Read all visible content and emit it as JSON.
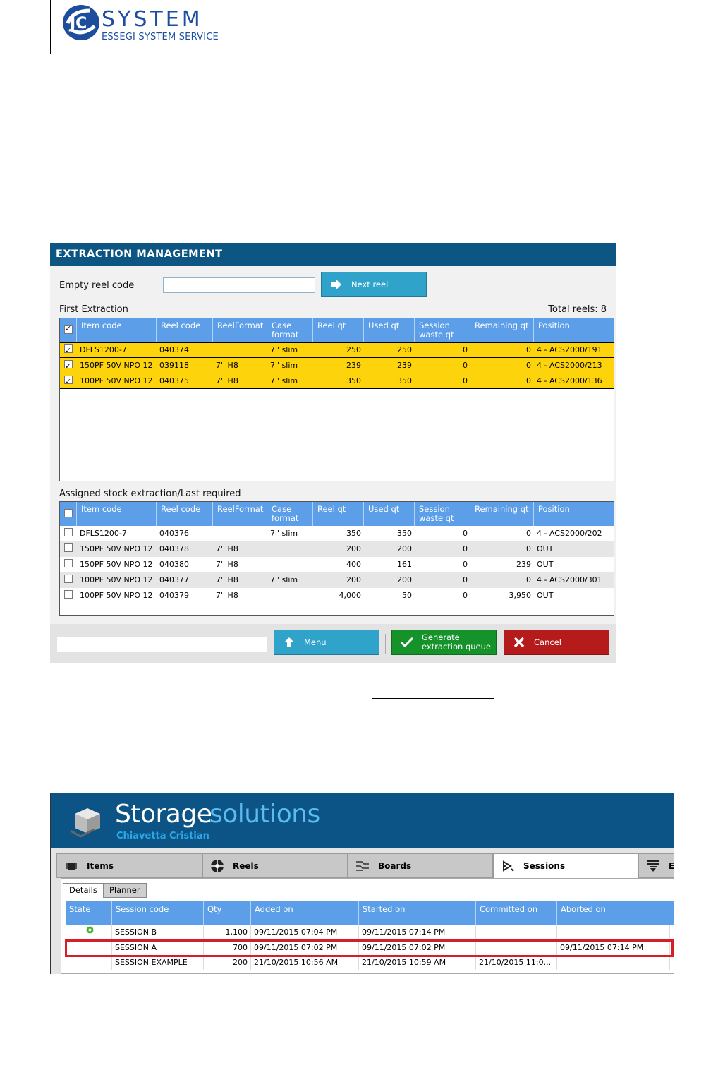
{
  "header": {
    "logo_text": "SYSTEM",
    "logo_subtitle": "ESSEGI SYSTEM SERVICE",
    "brand_color": "#1d4e9e"
  },
  "extraction": {
    "title": "EXTRACTION MANAGEMENT",
    "empty_reel_label": "Empty reel code",
    "empty_reel_value": "",
    "next_reel_label": "Next reel",
    "first_extraction_label": "First Extraction",
    "total_reels": "Total reels: 8",
    "columns": [
      "Item code",
      "Reel code",
      "ReelFormat",
      "Case format",
      "Reel qt",
      "Used qt",
      "Session waste qt",
      "Remaining qt",
      "Position"
    ],
    "first_rows": [
      {
        "checked": true,
        "item": "DFLS1200-7",
        "reel": "040374",
        "format": "",
        "case": "7'' slim",
        "reel_qt": "250",
        "used": "250",
        "waste": "0",
        "remaining": "0",
        "position": "4 - ACS2000/191"
      },
      {
        "checked": true,
        "item": "150PF 50V NPO 12",
        "reel": "039118",
        "format": "7'' H8",
        "case": "7'' slim",
        "reel_qt": "239",
        "used": "239",
        "waste": "0",
        "remaining": "0",
        "position": "4 - ACS2000/213"
      },
      {
        "checked": true,
        "item": "100PF 50V NPO 12",
        "reel": "040375",
        "format": "7'' H8",
        "case": "7'' slim",
        "reel_qt": "350",
        "used": "350",
        "waste": "0",
        "remaining": "0",
        "position": "4 - ACS2000/136"
      }
    ],
    "assigned_label": "Assigned stock extraction/Last required",
    "assigned_rows": [
      {
        "checked": false,
        "item": "DFLS1200-7",
        "reel": "040376",
        "format": "",
        "case": "7'' slim",
        "reel_qt": "350",
        "used": "350",
        "waste": "0",
        "remaining": "0",
        "position": "4 - ACS2000/202"
      },
      {
        "checked": false,
        "item": "150PF 50V NPO 12",
        "reel": "040378",
        "format": "7'' H8",
        "case": "",
        "reel_qt": "200",
        "used": "200",
        "waste": "0",
        "remaining": "0",
        "position": "OUT"
      },
      {
        "checked": false,
        "item": "150PF 50V NPO 12",
        "reel": "040380",
        "format": "7'' H8",
        "case": "",
        "reel_qt": "400",
        "used": "161",
        "waste": "0",
        "remaining": "239",
        "position": "OUT"
      },
      {
        "checked": false,
        "item": "100PF 50V NPO 12",
        "reel": "040377",
        "format": "7'' H8",
        "case": "7'' slim",
        "reel_qt": "200",
        "used": "200",
        "waste": "0",
        "remaining": "0",
        "position": "4 - ACS2000/301"
      },
      {
        "checked": false,
        "item": "100PF 50V NPO 12",
        "reel": "040379",
        "format": "7'' H8",
        "case": "",
        "reel_qt": "4,000",
        "used": "50",
        "waste": "0",
        "remaining": "3,950",
        "position": "OUT"
      }
    ],
    "menu_label": "Menu",
    "generate_label_1": "Generate",
    "generate_label_2": "extraction queue",
    "cancel_label": "Cancel",
    "colors": {
      "title_bar": "#0d5683",
      "grid_header": "#5c9ee8",
      "selected_row": "#fdd30b",
      "button_blue": "#2fa3c9",
      "button_green": "#16922b",
      "button_red": "#b51b1b"
    }
  },
  "storage": {
    "title_part1": "Storage",
    "title_part2": "solutions",
    "subtitle": "Chiavetta Cristian",
    "tabs": [
      {
        "label": "Items",
        "icon": "chip-icon"
      },
      {
        "label": "Reels",
        "icon": "reel-icon"
      },
      {
        "label": "Boards",
        "icon": "board-icon"
      },
      {
        "label": "Sessions",
        "icon": "sessions-icon"
      },
      {
        "label": "E",
        "icon": "filter-icon"
      }
    ],
    "subtabs": [
      "Details",
      "Planner"
    ],
    "columns": [
      "State",
      "Session code",
      "Qty",
      "Added on",
      "Started on",
      "Committed on",
      "Aborted on"
    ],
    "rows": [
      {
        "state": "gear-icon",
        "code": "SESSION B",
        "qty": "1,100",
        "added": "09/11/2015 07:04 PM",
        "started": "09/11/2015 07:14 PM",
        "committed": "",
        "aborted": ""
      },
      {
        "state": "",
        "code": "SESSION A",
        "qty": "700",
        "added": "09/11/2015 07:02 PM",
        "started": "09/11/2015 07:02 PM",
        "committed": "",
        "aborted": "09/11/2015 07:14 PM"
      },
      {
        "state": "",
        "code": "SESSION EXAMPLE",
        "qty": "200",
        "added": "21/10/2015 10:56 AM",
        "started": "21/10/2015 10:59 AM",
        "committed": "21/10/2015 11:0...",
        "aborted": ""
      }
    ],
    "highlight_color": "#d71d25"
  }
}
